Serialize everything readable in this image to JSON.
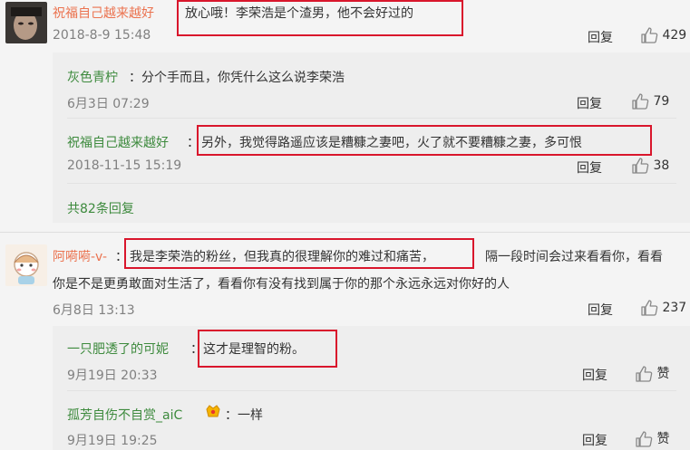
{
  "comments": [
    {
      "user": "祝福自己越来越好",
      "text": "放心哦！李荣浩是个渣男，他不会好过的",
      "time": "2018-8-9 15:48",
      "reply_label": "回复",
      "likes": "429",
      "replies": [
        {
          "user": "灰色青柠",
          "sep": "：",
          "text": "分个手而且，你凭什么这么说李荣浩",
          "time": "6月3日 07:29",
          "reply_label": "回复",
          "likes": "79"
        },
        {
          "user": "祝福自己越来越好",
          "sep": "：",
          "text": "另外，我觉得路遥应该是糟糠之妻吧，火了就不要糟糠之妻，多可恨",
          "time": "2018-11-15 15:19",
          "reply_label": "回复",
          "likes": "38"
        }
      ],
      "more_replies": "共82条回复"
    },
    {
      "user": "阿嗬嗬-v-",
      "sep": "：",
      "text_line1_hl": "我是李荣浩的粉丝，但我真的很理解你的难过和痛苦，",
      "text_line1_rest": "隔一段时间会过来看看你，看看",
      "text_line2": "你是不是更勇敢面对生活了，看看你有没有找到属于你的那个永远永远对你好的人",
      "time": "6月8日 13:13",
      "reply_label": "回复",
      "likes": "237",
      "replies": [
        {
          "user": "一只肥透了的可妮",
          "sep": "：",
          "text": "这才是理智的粉。",
          "time": "9月19日 20:33",
          "reply_label": "回复",
          "likes": "赞"
        },
        {
          "user": "孤芳自伤不自赏_aiC",
          "sep": "：",
          "text": "一样",
          "time": "9月19日 19:25",
          "reply_label": "回复",
          "likes": "赞"
        }
      ]
    }
  ],
  "colors": {
    "username": "#eb7350",
    "reply_username": "#3d8a3d",
    "highlight_box": "#d9162c"
  }
}
